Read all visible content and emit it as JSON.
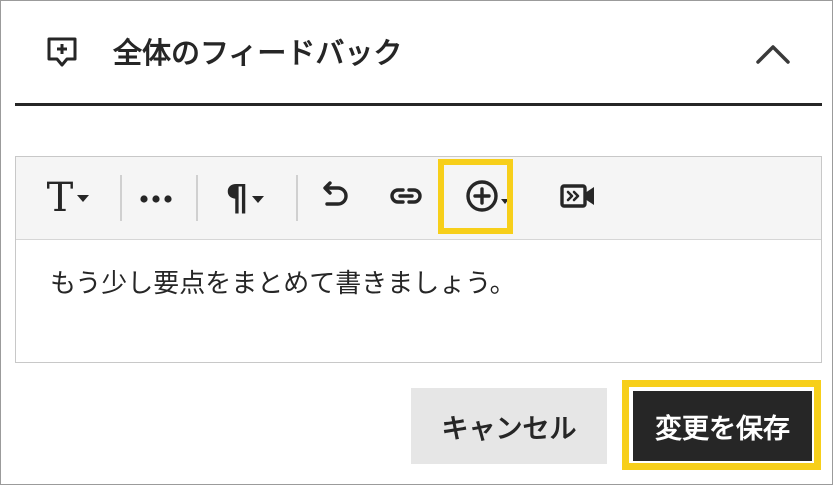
{
  "header": {
    "title": "全体のフィードバック",
    "icon": "comment-add-icon",
    "collapse_icon": "chevron-up-icon"
  },
  "toolbar": {
    "items": [
      {
        "name": "text-style",
        "icon": "text-format-icon",
        "glyph": "T"
      },
      {
        "name": "more",
        "icon": "more-horizontal-icon"
      },
      {
        "name": "paragraph",
        "icon": "paragraph-icon",
        "glyph": "¶"
      },
      {
        "name": "undo",
        "icon": "undo-icon"
      },
      {
        "name": "link",
        "icon": "link-icon"
      },
      {
        "name": "insert",
        "icon": "add-circle-icon"
      },
      {
        "name": "video",
        "icon": "video-icon"
      }
    ]
  },
  "editor": {
    "content": "もう少し要点をまとめて書きましょう。"
  },
  "buttons": {
    "cancel": "キャンセル",
    "save": "変更を保存"
  },
  "colors": {
    "highlight": "#f7cf1a",
    "primary": "#262626",
    "toolbar_bg": "#f5f5f5",
    "secondary_button_bg": "#e6e6e6"
  }
}
